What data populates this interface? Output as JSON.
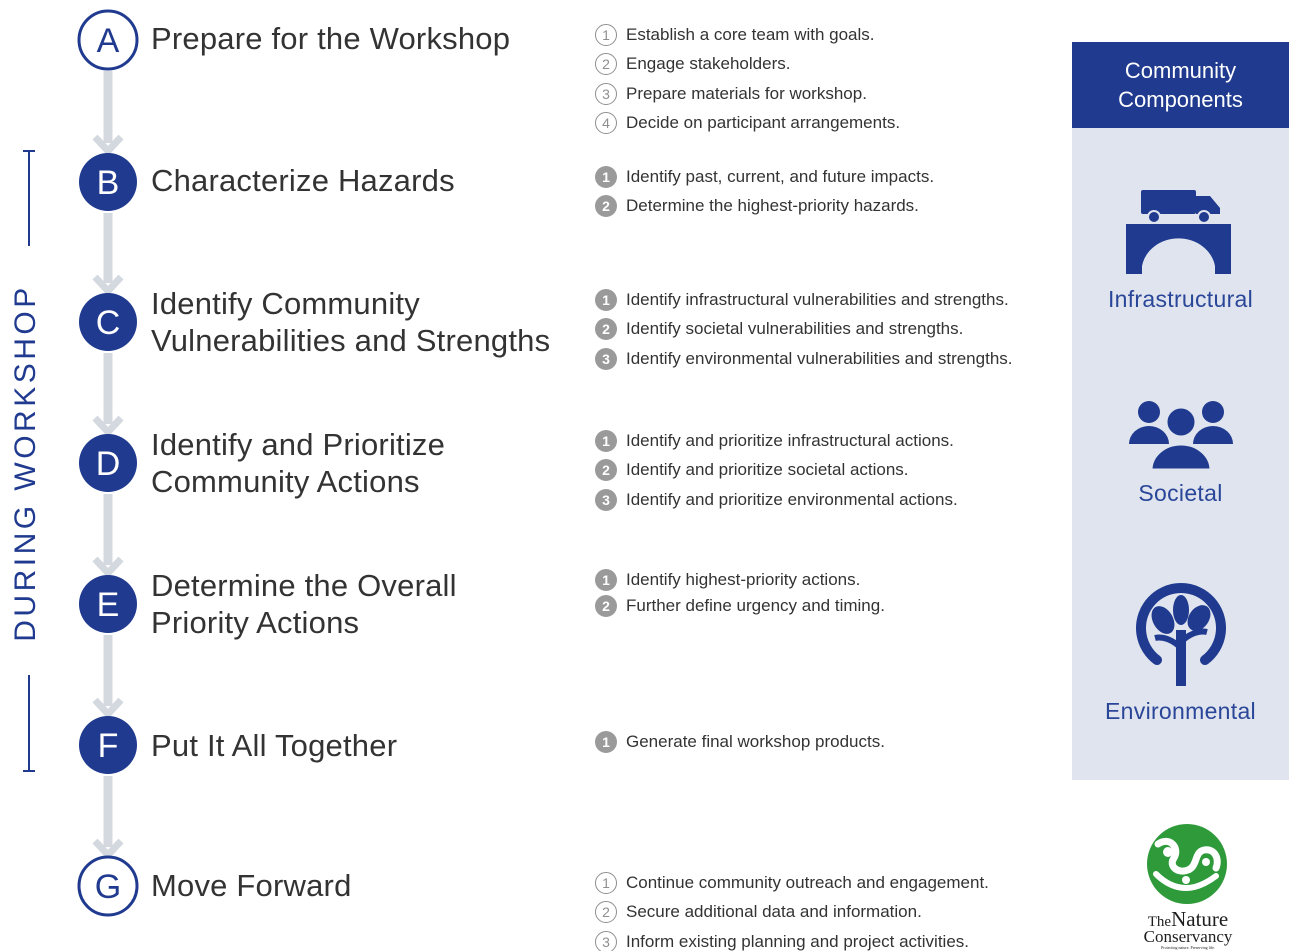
{
  "side_label": "DURING WORKSHOP",
  "steps": [
    {
      "letter": "A",
      "title": "Prepare for the Workshop",
      "style": "outline",
      "tasks": [
        {
          "n": "1",
          "text": "Establish a core team with goals.",
          "style": "outline"
        },
        {
          "n": "2",
          "text": "Engage stakeholders.",
          "style": "outline"
        },
        {
          "n": "3",
          "text": "Prepare materials for workshop.",
          "style": "outline"
        },
        {
          "n": "4",
          "text": "Decide on participant arrangements.",
          "style": "outline"
        }
      ]
    },
    {
      "letter": "B",
      "title": "Characterize Hazards",
      "style": "filled",
      "tasks": [
        {
          "n": "1",
          "text": "Identify past, current, and future impacts.",
          "style": "filled"
        },
        {
          "n": "2",
          "text": "Determine the highest-priority hazards.",
          "style": "filled"
        }
      ]
    },
    {
      "letter": "C",
      "title": "Identify Community\nVulnerabilities and Strengths",
      "style": "filled",
      "tasks": [
        {
          "n": "1",
          "text": "Identify infrastructural vulnerabilities and strengths.",
          "style": "filled"
        },
        {
          "n": "2",
          "text": "Identify societal vulnerabilities and strengths.",
          "style": "filled"
        },
        {
          "n": "3",
          "text": "Identify environmental vulnerabilities and strengths.",
          "style": "filled"
        }
      ]
    },
    {
      "letter": "D",
      "title": "Identify and Prioritize\nCommunity Actions",
      "style": "filled",
      "tasks": [
        {
          "n": "1",
          "text": "Identify and prioritize infrastructural actions.",
          "style": "filled"
        },
        {
          "n": "2",
          "text": "Identify and prioritize societal actions.",
          "style": "filled"
        },
        {
          "n": "3",
          "text": "Identify and prioritize environmental actions.",
          "style": "filled"
        }
      ]
    },
    {
      "letter": "E",
      "title": "Determine the Overall\nPriority Actions",
      "style": "filled",
      "tasks": [
        {
          "n": "1",
          "text": "Identify highest-priority actions.",
          "style": "filled"
        },
        {
          "n": "2",
          "text": "Further define urgency and timing.",
          "style": "filled"
        }
      ]
    },
    {
      "letter": "F",
      "title": "Put It All Together",
      "style": "filled",
      "tasks": [
        {
          "n": "1",
          "text": "Generate final workshop products.",
          "style": "filled"
        }
      ]
    },
    {
      "letter": "G",
      "title": "Move Forward",
      "style": "outline",
      "tasks": [
        {
          "n": "1",
          "text": "Continue community outreach and engagement.",
          "style": "outline"
        },
        {
          "n": "2",
          "text": "Secure additional data and information.",
          "style": "outline"
        },
        {
          "n": "3",
          "text": "Inform existing planning and project activities.",
          "style": "outline"
        }
      ]
    }
  ],
  "components": {
    "heading": "Community\nComponents",
    "items": [
      {
        "label": "Infrastructural",
        "icon": "bridge-truck-icon"
      },
      {
        "label": "Societal",
        "icon": "people-group-icon"
      },
      {
        "label": "Environmental",
        "icon": "tree-icon"
      }
    ]
  },
  "logo": {
    "line1_small": "The",
    "line1_big": "Nature",
    "line2": "Conservancy",
    "tagline": "Protecting nature. Preserving life."
  },
  "colors": {
    "accent": "#1f3a8f",
    "panel": "#dfe4ee",
    "arrow": "#d4d8df",
    "number_fill": "#9a9a9a",
    "logo_green": "#2e9a3a"
  }
}
